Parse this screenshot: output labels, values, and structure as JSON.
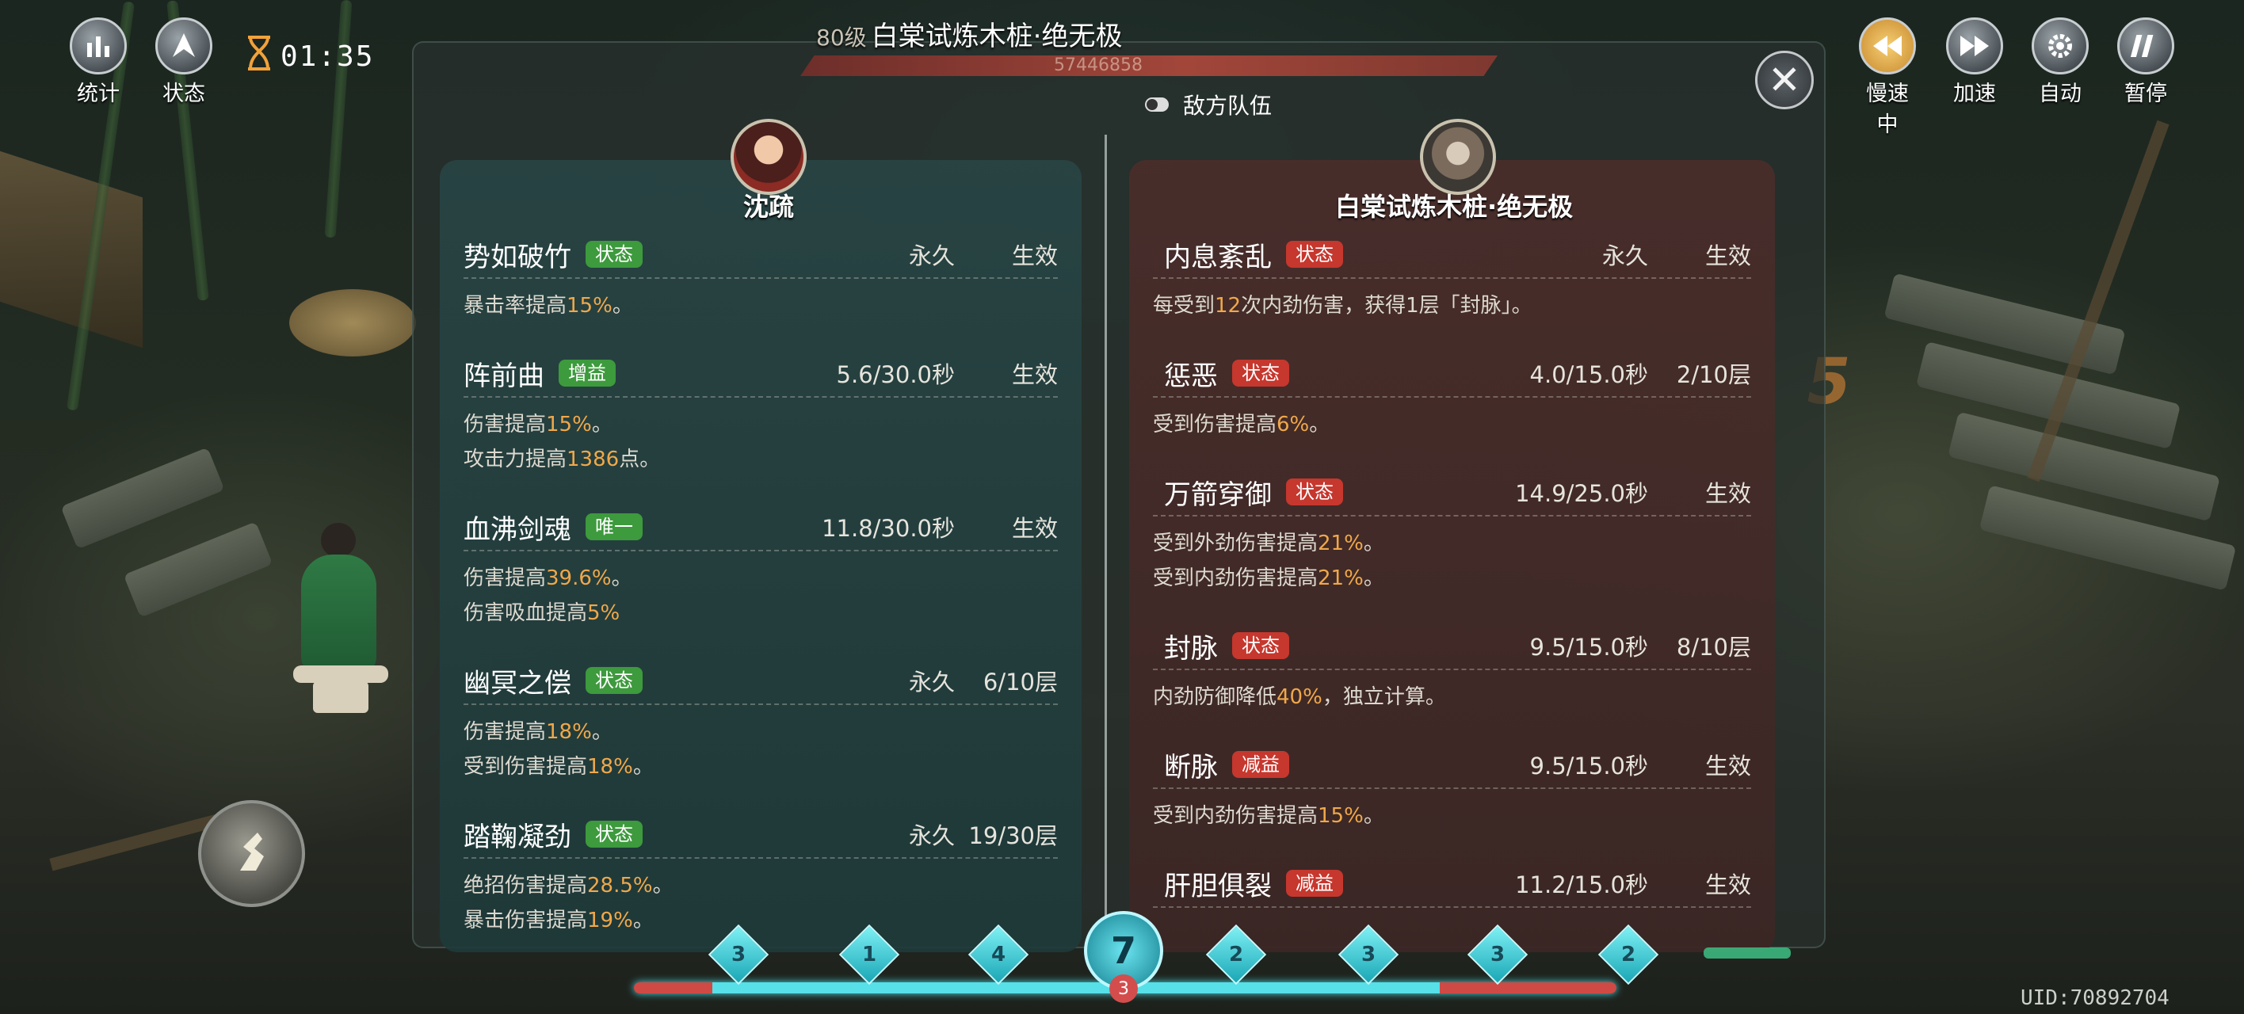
{
  "hud": {
    "stats_label": "统计",
    "status_label": "状态",
    "timer": "01:35",
    "slow_label": "慢速中",
    "speed_label": "加速",
    "auto_label": "自动",
    "pause_label": "暂停",
    "hourglass_icon": "hourglass-icon",
    "stats_icon": "bar-chart-icon",
    "status_icon": "status-icon"
  },
  "boss": {
    "level": "80级",
    "name": "白棠试炼木桩·绝无极",
    "hp": "57446858"
  },
  "panel": {
    "enemy_team_label": "敌方队伍",
    "left": {
      "name": "沈疏",
      "buffs": [
        {
          "name": "势如破竹",
          "tag": "状态",
          "tag_color": "green",
          "time": "永久",
          "state": "生效",
          "desc": [
            [
              "暴击率提高",
              "15%",
              "。"
            ]
          ]
        },
        {
          "name": "阵前曲",
          "tag": "增益",
          "tag_color": "green",
          "time": "5.6/30.0秒",
          "state": "生效",
          "desc": [
            [
              "伤害提高",
              "15%",
              "。"
            ],
            [
              "攻击力提高",
              "1386",
              "点。"
            ]
          ]
        },
        {
          "name": "血沸剑魂",
          "tag": "唯一",
          "tag_color": "green",
          "time": "11.8/30.0秒",
          "state": "生效",
          "desc": [
            [
              "伤害提高",
              "39.6%",
              "。"
            ],
            [
              "伤害吸血提高",
              "5%",
              ""
            ]
          ]
        },
        {
          "name": "幽冥之偿",
          "tag": "状态",
          "tag_color": "green",
          "time": "永久",
          "state": "6/10层",
          "desc": [
            [
              "伤害提高",
              "18%",
              "。"
            ],
            [
              "受到伤害提高",
              "18%",
              "。"
            ]
          ]
        },
        {
          "name": "踏鞠凝劲",
          "tag": "状态",
          "tag_color": "green",
          "time": "永久",
          "state": "19/30层",
          "desc": [
            [
              "绝招伤害提高",
              "28.5%",
              "。"
            ],
            [
              "暴击伤害提高",
              "19%",
              "。"
            ]
          ]
        }
      ]
    },
    "right": {
      "name": "白棠试炼木桩·绝无极",
      "buffs": [
        {
          "name": "内息紊乱",
          "tag": "状态",
          "tag_color": "red",
          "time": "永久",
          "state": "生效",
          "desc": [
            [
              "每受到",
              "12",
              "次内劲伤害，获得1层「封脉」。"
            ]
          ]
        },
        {
          "name": "惩恶",
          "tag": "状态",
          "tag_color": "red",
          "time": "4.0/15.0秒",
          "state": "2/10层",
          "desc": [
            [
              "受到伤害提高",
              "6%",
              "。"
            ]
          ]
        },
        {
          "name": "万箭穿御",
          "tag": "状态",
          "tag_color": "red",
          "time": "14.9/25.0秒",
          "state": "生效",
          "desc": [
            [
              "受到外劲伤害提高",
              "21%",
              "。"
            ],
            [
              "受到内劲伤害提高",
              "21%",
              "。"
            ]
          ]
        },
        {
          "name": "封脉",
          "tag": "状态",
          "tag_color": "red",
          "time": "9.5/15.0秒",
          "state": "8/10层",
          "desc": [
            [
              "内劲防御降低",
              "40%",
              "，独立计算。"
            ]
          ]
        },
        {
          "name": "断脉",
          "tag": "减益",
          "tag_color": "red",
          "time": "9.5/15.0秒",
          "state": "生效",
          "desc": [
            [
              "受到内劲伤害提高",
              "15%",
              "。"
            ]
          ]
        },
        {
          "name": "肝胆俱裂",
          "tag": "减益",
          "tag_color": "red",
          "time": "11.2/15.0秒",
          "state": "生效",
          "desc": []
        }
      ]
    }
  },
  "skills": {
    "gems": [
      "3",
      "1",
      "4",
      "2",
      "3",
      "3",
      "2"
    ],
    "center": "7",
    "center_sub": "3"
  },
  "uid": "UID:70892704",
  "colors": {
    "highlight": "#f0a84a",
    "tag_green": "#3d9a3d",
    "tag_red": "#c6372e"
  }
}
